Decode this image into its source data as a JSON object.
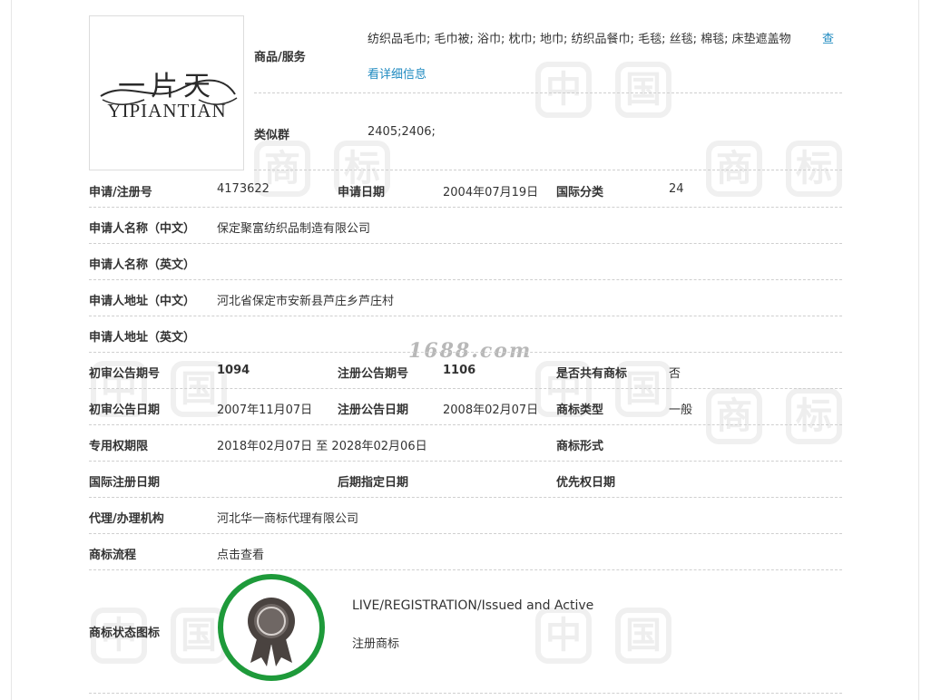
{
  "watermark": {
    "chars": [
      "中",
      "国",
      "商",
      "标"
    ],
    "site": "1688.com"
  },
  "logo": {
    "chinese_text": "一片天",
    "english_text": "YIPIANTIAN"
  },
  "goods": {
    "label": "商品/服务",
    "value": "纺织品毛巾; 毛巾被; 浴巾; 枕巾; 地巾; 纺织品餐巾; 毛毯; 丝毯; 棉毯; 床垫遮盖物",
    "link_part1": "查",
    "link_part2": "看详细信息"
  },
  "similar_group": {
    "label": "类似群",
    "value": "2405;2406;"
  },
  "rows": {
    "reg_no_label": "申请/注册号",
    "reg_no": "4173622",
    "apply_date_label": "申请日期",
    "apply_date": "2004年07月19日",
    "intl_class_label": "国际分类",
    "intl_class": "24",
    "applicant_cn_label": "申请人名称（中文）",
    "applicant_cn": "保定聚富纺织品制造有限公司",
    "applicant_en_label": "申请人名称（英文）",
    "applicant_en": "",
    "address_cn_label": "申请人地址（中文）",
    "address_cn": "河北省保定市安新县芦庄乡芦庄村",
    "address_en_label": "申请人地址（英文）",
    "address_en": "",
    "prelim_no_label": "初审公告期号",
    "prelim_no": "1094",
    "reg_pub_no_label": "注册公告期号",
    "reg_pub_no": "1106",
    "shared_label": "是否共有商标",
    "shared": "否",
    "prelim_date_label": "初审公告日期",
    "prelim_date": "2007年11月07日",
    "reg_pub_date_label": "注册公告日期",
    "reg_pub_date": "2008年02月07日",
    "tm_type_label": "商标类型",
    "tm_type": "一般",
    "exclusive_label": "专用权期限",
    "exclusive": "2018年02月07日 至 2028年02月06日",
    "tm_form_label": "商标形式",
    "tm_form": "",
    "intl_reg_date_label": "国际注册日期",
    "intl_reg_date": "",
    "later_date_label": "后期指定日期",
    "later_date": "",
    "priority_date_label": "优先权日期",
    "priority_date": "",
    "agent_label": "代理/办理机构",
    "agent": "河北华一商标代理有限公司",
    "process_label": "商标流程",
    "process_link": "点击查看",
    "status_icon_label": "商标状态图标"
  },
  "status": {
    "english": "LIVE/REGISTRATION/Issued and Active",
    "chinese": "注册商标",
    "seal_color": "#1e9a3a"
  },
  "colors": {
    "link": "#1f8ac0",
    "text": "#333333"
  }
}
